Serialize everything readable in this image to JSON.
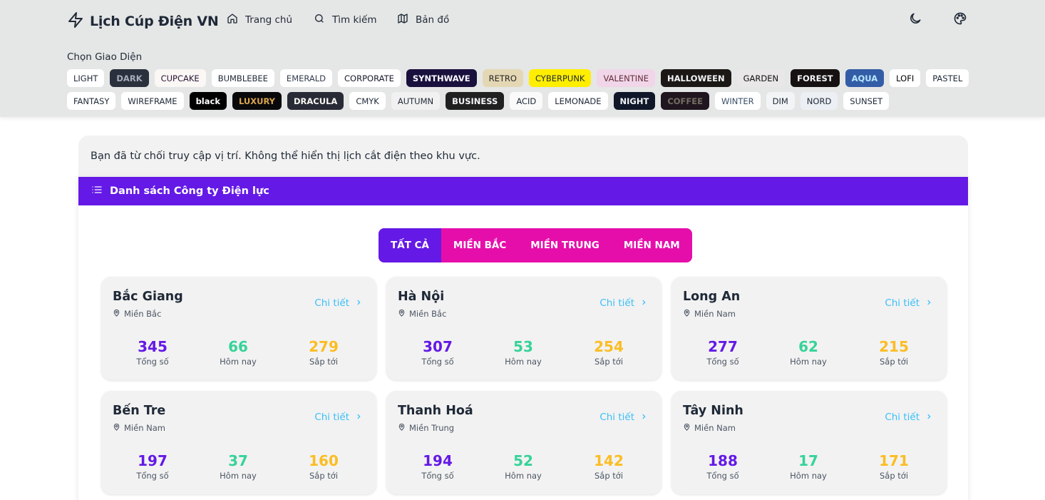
{
  "brand": {
    "title": "Lịch Cúp Điện VN",
    "icon": "lightning-icon"
  },
  "nav": [
    {
      "label": "Trang chủ",
      "icon": "home-icon"
    },
    {
      "label": "Tìm kiếm",
      "icon": "search-icon"
    },
    {
      "label": "Bản đồ",
      "icon": "map-icon"
    }
  ],
  "header_icons": [
    "moon-icon",
    "palette-icon"
  ],
  "theme_picker": {
    "label": "Chọn Giao Diện",
    "row1": [
      {
        "label": "LIGHT",
        "bg": "#ffffff",
        "fg": "#1f2937"
      },
      {
        "label": "DARK",
        "bg": "#2a303c",
        "fg": "#a6adbb"
      },
      {
        "label": "CUPCAKE",
        "bg": "#faf7f5",
        "fg": "#291334"
      },
      {
        "label": "BUMBLEBEE",
        "bg": "#ffffff",
        "fg": "#1f2937"
      },
      {
        "label": "EMERALD",
        "bg": "#ffffff",
        "fg": "#333c4d"
      },
      {
        "label": "CORPORATE",
        "bg": "#ffffff",
        "fg": "#181a2a"
      },
      {
        "label": "SYNTHWAVE",
        "bg": "#1a103d",
        "fg": "#f9f7fd"
      },
      {
        "label": "RETRO",
        "bg": "#e4d8b4",
        "fg": "#282425"
      },
      {
        "label": "CYBERPUNK",
        "bg": "#ffee00",
        "fg": "#1f2937"
      },
      {
        "label": "VALENTINE",
        "bg": "#f0d6e8",
        "fg": "#632c3b"
      },
      {
        "label": "HALLOWEEN",
        "bg": "#1b1816",
        "fg": "#f3f4f6"
      },
      {
        "label": "GARDEN",
        "bg": "#e9e7e7",
        "fg": "#100f0f"
      },
      {
        "label": "FOREST",
        "bg": "#171212",
        "fg": "#f3f4f6"
      },
      {
        "label": "AQUA",
        "bg": "#345da7",
        "fg": "#b8e6fe"
      },
      {
        "label": "LOFI",
        "bg": "#ffffff",
        "fg": "#000000"
      },
      {
        "label": "PASTEL",
        "bg": "#ffffff",
        "fg": "#1f2937"
      }
    ],
    "row2": [
      {
        "label": "FANTASY",
        "bg": "#ffffff",
        "fg": "#1f2937"
      },
      {
        "label": "WIREFRAME",
        "bg": "#ffffff",
        "fg": "#1f2937"
      },
      {
        "label": "black",
        "bg": "#000000",
        "fg": "#ffffff"
      },
      {
        "label": "LUXURY",
        "bg": "#09090b",
        "fg": "#dca54c"
      },
      {
        "label": "DRACULA",
        "bg": "#282a36",
        "fg": "#f8f8f2"
      },
      {
        "label": "CMYK",
        "bg": "#ffffff",
        "fg": "#1f2937"
      },
      {
        "label": "AUTUMN",
        "bg": "#f1f1f1",
        "fg": "#1f2937"
      },
      {
        "label": "BUSINESS",
        "bg": "#202020",
        "fg": "#f3f4f6"
      },
      {
        "label": "ACID",
        "bg": "#fafafa",
        "fg": "#1f2937"
      },
      {
        "label": "LEMONADE",
        "bg": "#ffffff",
        "fg": "#1f2937"
      },
      {
        "label": "NIGHT",
        "bg": "#0f1729",
        "fg": "#f3f4f6"
      },
      {
        "label": "COFFEE",
        "bg": "#20161f",
        "fg": "#756e63"
      },
      {
        "label": "WINTER",
        "bg": "#ffffff",
        "fg": "#394e6a"
      },
      {
        "label": "DIM",
        "bg": "#f3f4f6",
        "fg": "#1f2937"
      },
      {
        "label": "NORD",
        "bg": "#eceff4",
        "fg": "#1f2937"
      },
      {
        "label": "SUNSET",
        "bg": "#ffffff",
        "fg": "#1f2937"
      }
    ]
  },
  "alert": {
    "text": "Bạn đã từ chối truy cập vị trí. Không thể hiển thị lịch cắt điện theo khu vực."
  },
  "panel": {
    "title": "Danh sách Công ty Điện lực",
    "icon": "list-icon"
  },
  "tabs": [
    {
      "label": "TẤT CẢ",
      "active": true
    },
    {
      "label": "MIỀN BẮC",
      "active": false
    },
    {
      "label": "MIỀN TRUNG",
      "active": false
    },
    {
      "label": "MIỀN NAM",
      "active": false
    }
  ],
  "card_labels": {
    "detail": "Chi tiết",
    "total": "Tổng số",
    "today": "Hôm nay",
    "upcoming": "Sắp tới"
  },
  "colors": {
    "primary": "#6419e6",
    "secondary": "#e60eaa",
    "total": "#6419e6",
    "today": "#36d399",
    "upcoming": "#fbbd23",
    "link": "#3abff8"
  },
  "companies": [
    {
      "name": "Bắc Giang",
      "region": "Miền Bắc",
      "total": "345",
      "today": "66",
      "upcoming": "279"
    },
    {
      "name": "Hà Nội",
      "region": "Miền Bắc",
      "total": "307",
      "today": "53",
      "upcoming": "254"
    },
    {
      "name": "Long An",
      "region": "Miền Nam",
      "total": "277",
      "today": "62",
      "upcoming": "215"
    },
    {
      "name": "Bến Tre",
      "region": "Miền Nam",
      "total": "197",
      "today": "37",
      "upcoming": "160"
    },
    {
      "name": "Thanh Hoá",
      "region": "Miền Trung",
      "total": "194",
      "today": "52",
      "upcoming": "142"
    },
    {
      "name": "Tây Ninh",
      "region": "Miền Nam",
      "total": "188",
      "today": "17",
      "upcoming": "171"
    }
  ]
}
